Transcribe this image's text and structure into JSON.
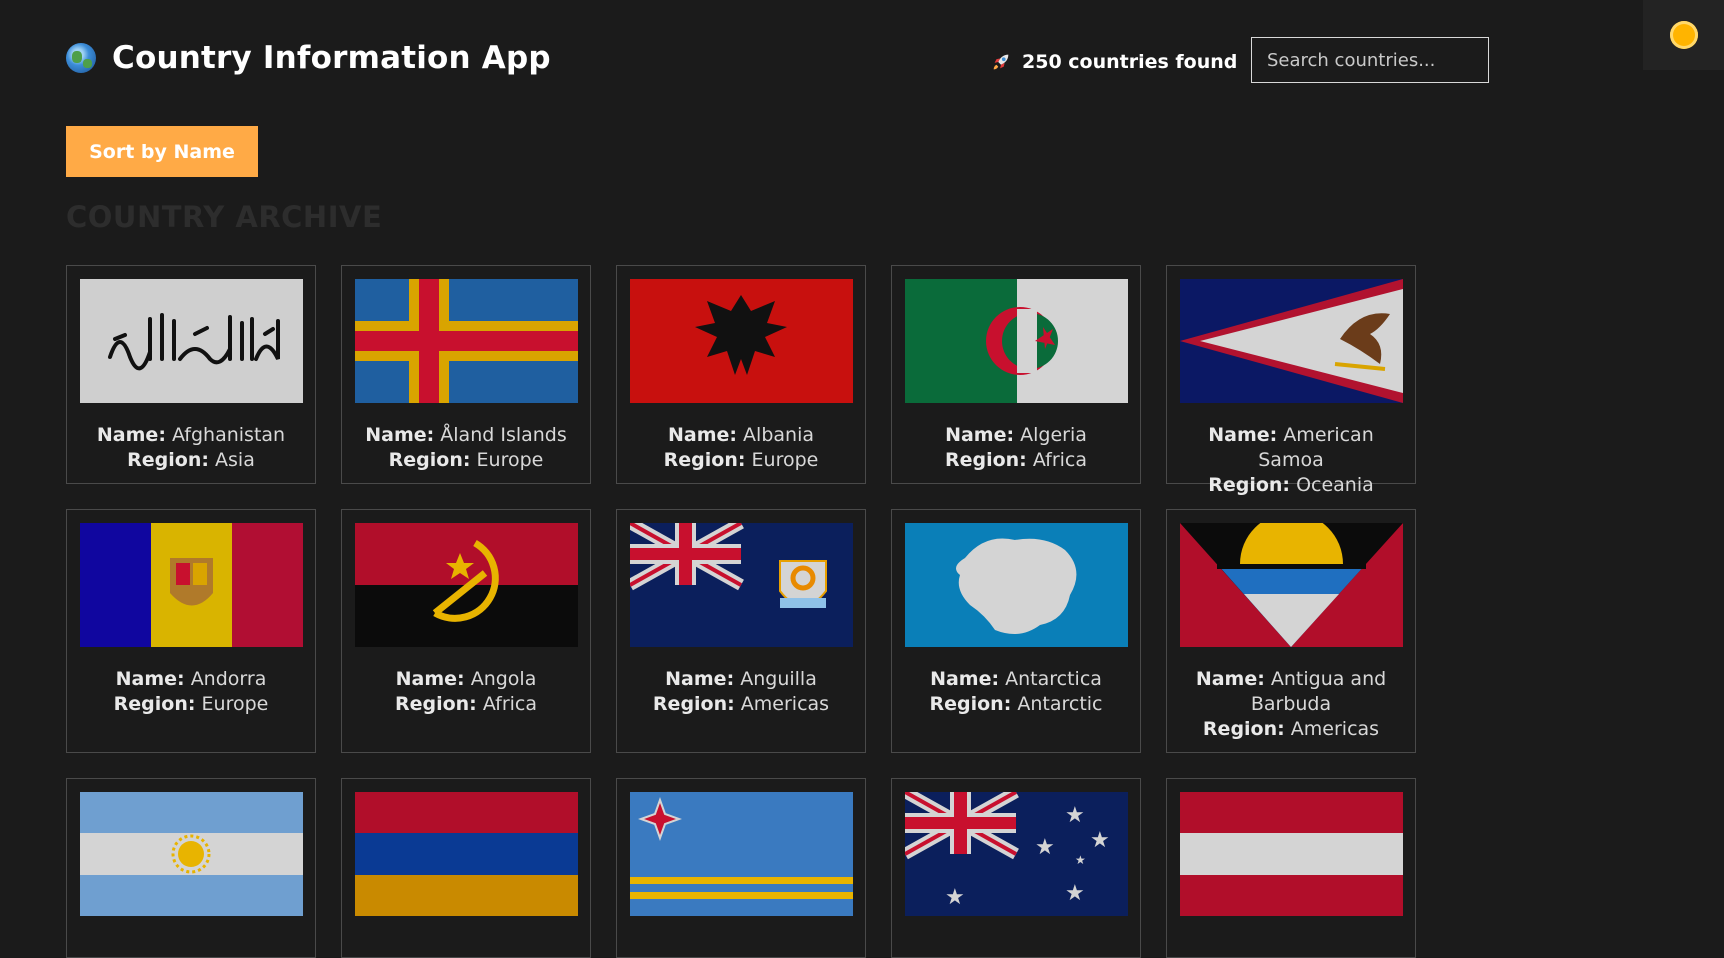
{
  "app": {
    "title": "Country Information App",
    "count_text": "250 countries found"
  },
  "search": {
    "placeholder": "Search countries..."
  },
  "sort": {
    "label": "Sort by Name"
  },
  "section": {
    "title": "COUNTRY ARCHIVE"
  },
  "labels": {
    "name": "Name:",
    "region": "Region:"
  },
  "countries": [
    {
      "name": "Afghanistan",
      "region": "Asia",
      "flag_icon": "afghanistan-flag-icon"
    },
    {
      "name": "Åland Islands",
      "region": "Europe",
      "flag_icon": "aland-islands-flag-icon"
    },
    {
      "name": "Albania",
      "region": "Europe",
      "flag_icon": "albania-flag-icon"
    },
    {
      "name": "Algeria",
      "region": "Africa",
      "flag_icon": "algeria-flag-icon"
    },
    {
      "name": "American Samoa",
      "region": "Oceania",
      "flag_icon": "american-samoa-flag-icon"
    },
    {
      "name": "Andorra",
      "region": "Europe",
      "flag_icon": "andorra-flag-icon"
    },
    {
      "name": "Angola",
      "region": "Africa",
      "flag_icon": "angola-flag-icon"
    },
    {
      "name": "Anguilla",
      "region": "Americas",
      "flag_icon": "anguilla-flag-icon"
    },
    {
      "name": "Antarctica",
      "region": "Antarctic",
      "flag_icon": "antarctica-flag-icon"
    },
    {
      "name": "Antigua and Barbuda",
      "region": "Americas",
      "flag_icon": "antigua-and-barbuda-flag-icon"
    },
    {
      "flag_icon": "argentina-flag-icon"
    },
    {
      "flag_icon": "armenia-flag-icon"
    },
    {
      "flag_icon": "aruba-flag-icon"
    },
    {
      "flag_icon": "australia-flag-icon"
    },
    {
      "flag_icon": "austria-flag-icon"
    }
  ],
  "colors": {
    "accent": "#ffaa46",
    "background": "#1b1b1b",
    "card_border": "#4a4a4a",
    "sun": "#ffb400"
  }
}
